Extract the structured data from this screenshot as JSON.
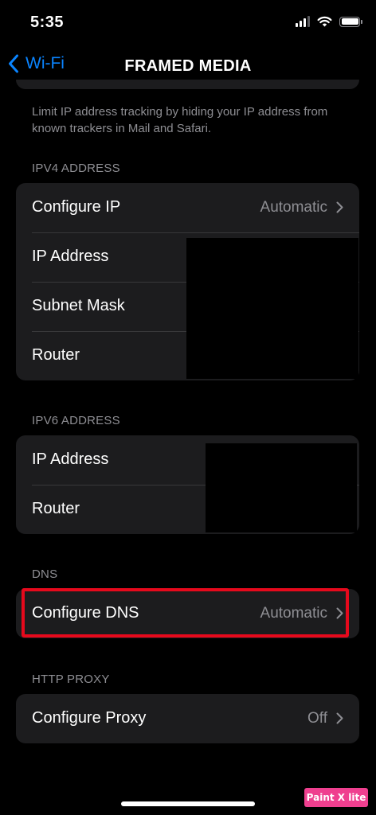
{
  "status_bar": {
    "time": "5:35"
  },
  "nav": {
    "back_label": "Wi-Fi",
    "title": "FRAMED MEDIA"
  },
  "private_address_note": "Limit IP address tracking by hiding your IP address from known trackers in Mail and Safari.",
  "ipv4": {
    "header": "IPV4 ADDRESS",
    "rows": [
      {
        "label": "Configure IP",
        "value": "Automatic"
      },
      {
        "label": "IP Address"
      },
      {
        "label": "Subnet Mask"
      },
      {
        "label": "Router"
      }
    ]
  },
  "ipv6": {
    "header": "IPV6 ADDRESS",
    "rows": [
      {
        "label": "IP Address"
      },
      {
        "label": "Router"
      }
    ]
  },
  "dns": {
    "header": "DNS",
    "rows": [
      {
        "label": "Configure DNS",
        "value": "Automatic"
      }
    ]
  },
  "http_proxy": {
    "header": "HTTP PROXY",
    "rows": [
      {
        "label": "Configure Proxy",
        "value": "Off"
      }
    ]
  },
  "colors": {
    "accent": "#0a84ff",
    "background": "#000000",
    "card": "#1c1c1e",
    "secondary_text": "#8e8e93",
    "highlight": "#e6091c"
  },
  "watermark": "Paint X lite"
}
